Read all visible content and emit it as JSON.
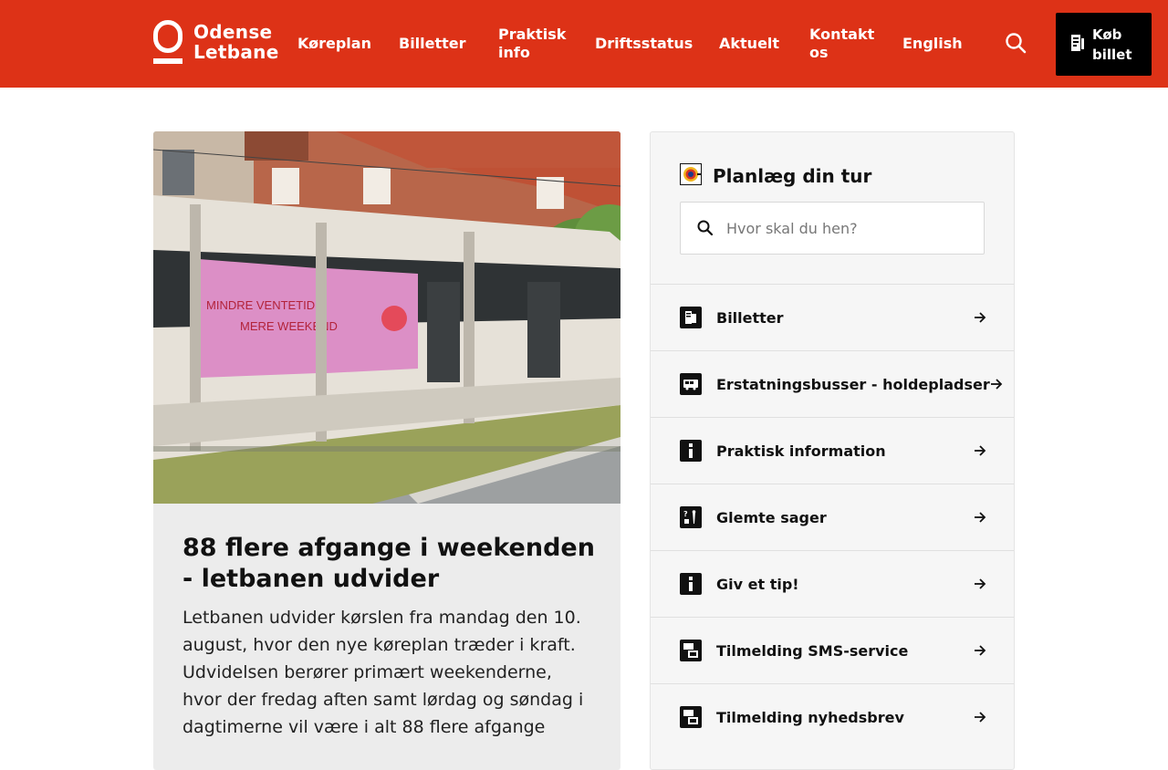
{
  "brand": {
    "line1": "Odense",
    "line2": "Letbane",
    "color_primary": "#dd3217"
  },
  "nav": {
    "items": [
      {
        "label": "Køreplan"
      },
      {
        "label": "Billetter"
      },
      {
        "label": "Praktisk info"
      },
      {
        "label": "Driftsstatus"
      },
      {
        "label": "Aktuelt"
      },
      {
        "label": "Kontakt os"
      },
      {
        "label": "English"
      }
    ],
    "search_icon": "search-icon",
    "buy_button": {
      "label": "Køb billet",
      "icon": "ticket-icon"
    }
  },
  "article": {
    "image_alt_text": "MINDRE VENTETID ♥ MERE WEEKEND",
    "title": "88 flere afgange i weekenden - letbanen udvider",
    "body": "Letbanen udvider kørslen fra mandag den 10. august, hvor den nye køreplan træder i kraft. Udvidelsen berører primært weekenderne, hvor der fredag aften samt lørdag og søndag i dagtimerne vil være i alt 88 flere afgange"
  },
  "planner": {
    "title": "Planlæg din tur",
    "search_placeholder": "Hvor skal du hen?"
  },
  "links": [
    {
      "label": "Billetter",
      "icon": "ticket-icon"
    },
    {
      "label": "Erstatningsbusser - holdepladser",
      "icon": "bus-icon"
    },
    {
      "label": "Praktisk information",
      "icon": "info-icon"
    },
    {
      "label": "Glemte sager",
      "icon": "lost-items-icon"
    },
    {
      "label": "Giv et tip!",
      "icon": "info-icon"
    },
    {
      "label": "Tilmelding SMS-service",
      "icon": "sms-icon"
    },
    {
      "label": "Tilmelding nyhedsbrev",
      "icon": "newsletter-icon"
    }
  ]
}
